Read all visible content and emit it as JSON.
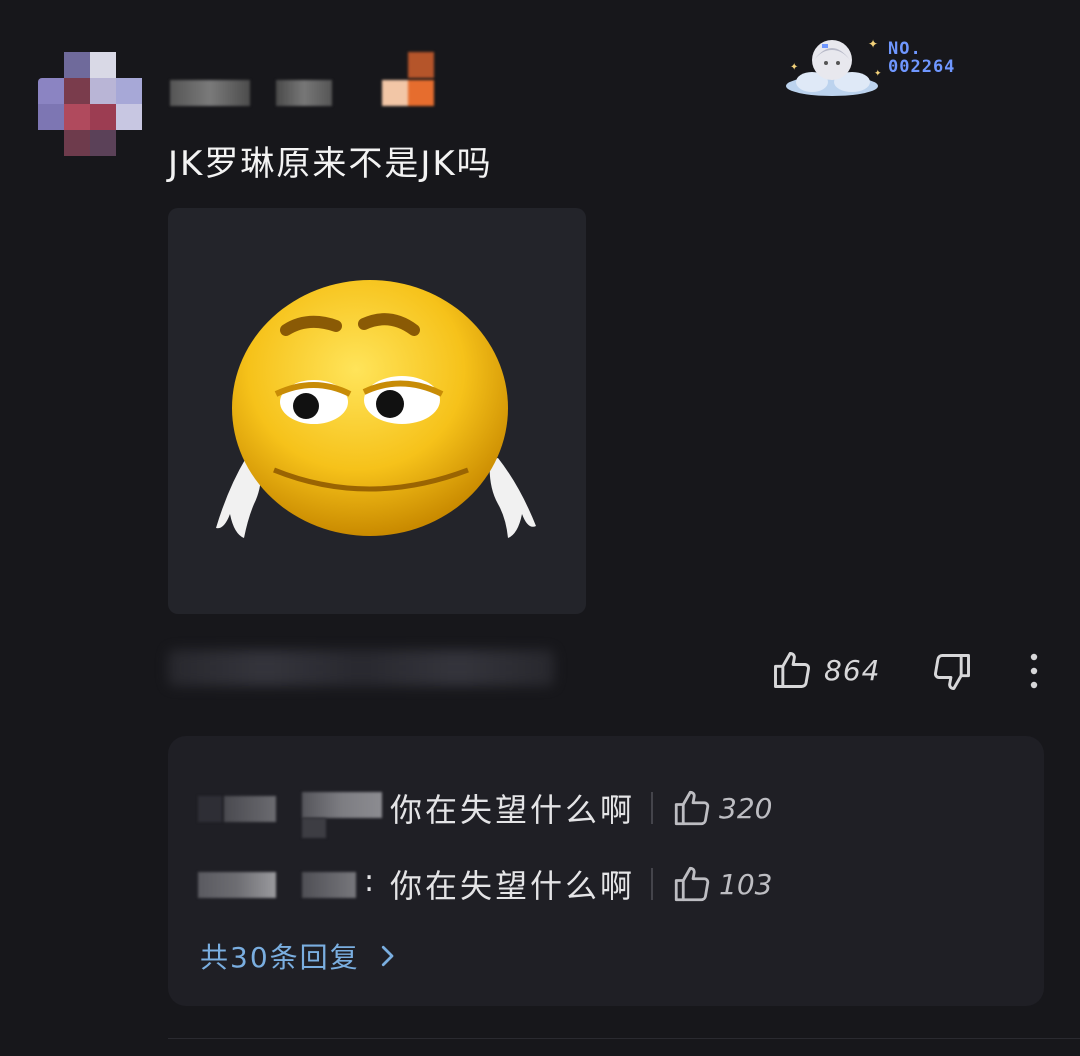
{
  "comment": {
    "text": "JK罗琳原来不是JK吗",
    "like_count": "864"
  },
  "badge": {
    "label": "NO.\n002264"
  },
  "replies": {
    "items": [
      {
        "text": "你在失望什么啊",
        "like_count": "320"
      },
      {
        "text": "你在失望什么啊",
        "like_count": "103"
      }
    ],
    "more_label": "共30条回复"
  },
  "colors": {
    "background": "#17171b",
    "reply_panel": "#1f1f25",
    "link_blue": "#7aaee0",
    "badge_blue": "#6f97ff"
  },
  "icons": [
    "thumbs-up-icon",
    "thumbs-down-icon",
    "more-vertical-icon",
    "chevron-right-icon"
  ]
}
